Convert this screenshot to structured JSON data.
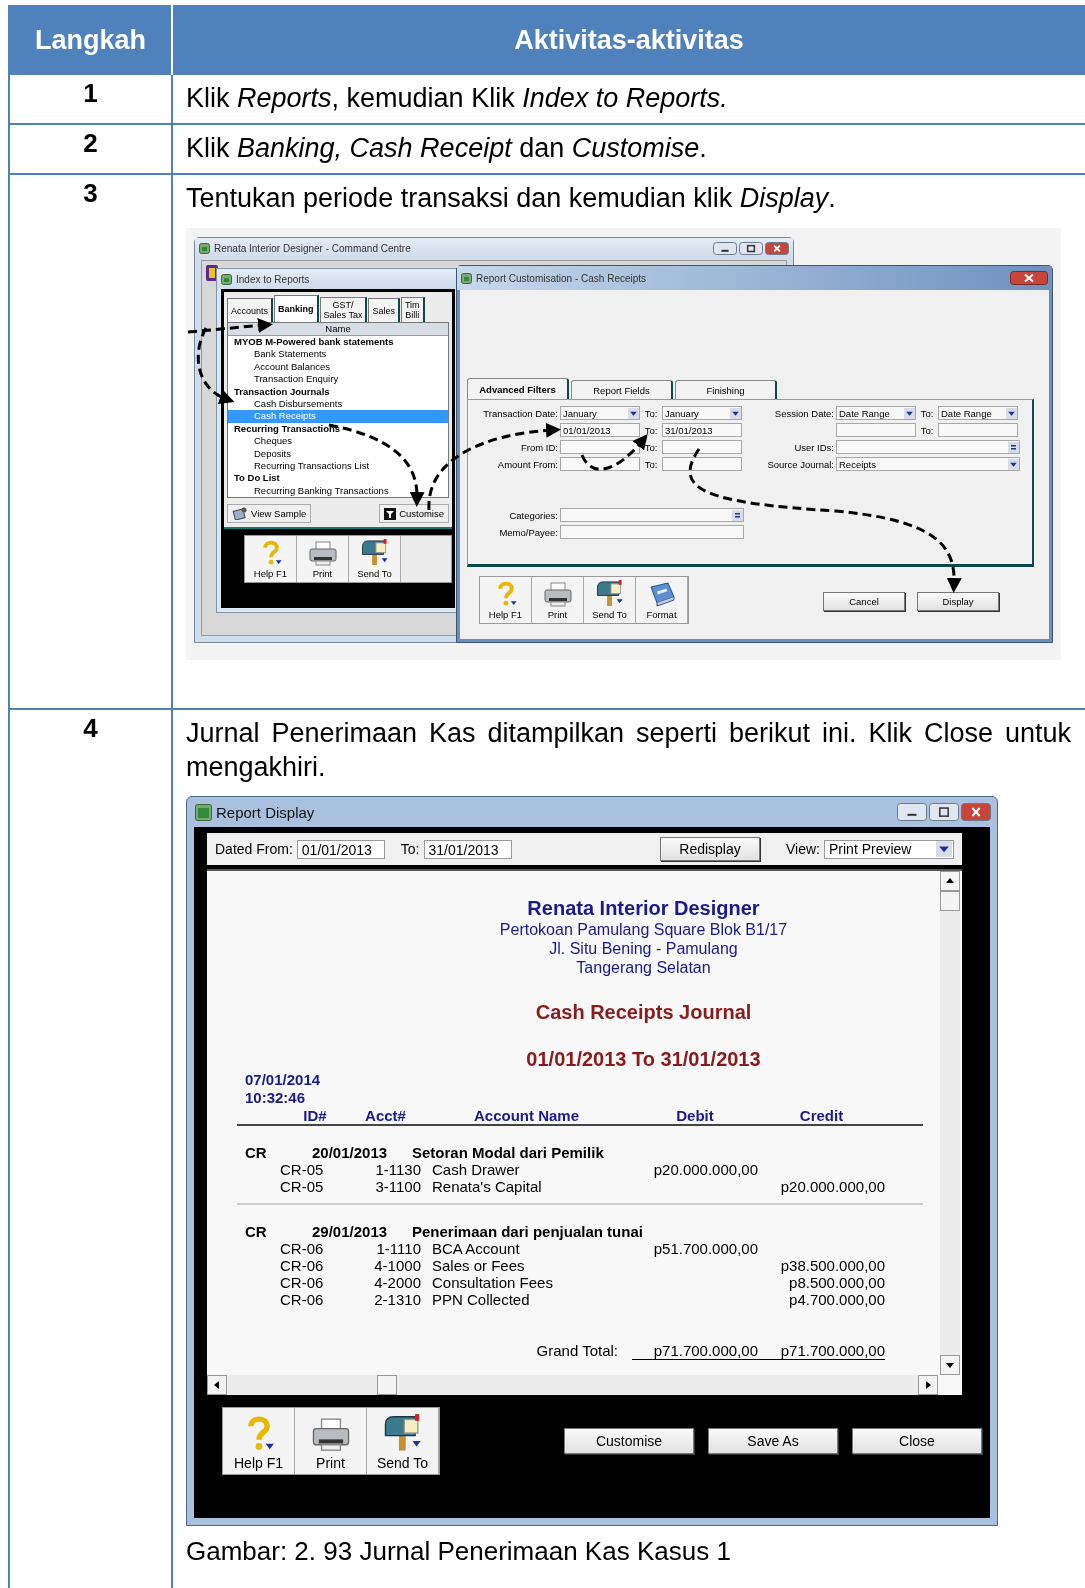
{
  "header": {
    "step": "Langkah",
    "activities": "Aktivitas-aktivitas"
  },
  "steps": [
    {
      "number": "1",
      "text": "Klik *Reports*, kemudian Klik *Index to Reports.*"
    },
    {
      "number": "2",
      "text": "Klik *Banking, Cash Receipt* dan *Customise*."
    },
    {
      "number": "3",
      "text": "Tentukan periode transaksi dan kemudian klik *Display*.",
      "figure": {
        "kind": "customise",
        "command_centre": {
          "title": "Renata Interior Designer - Command Centre"
        },
        "index": {
          "title": "Index to Reports",
          "tabs": [
            {
              "label": "Accounts",
              "selected": false
            },
            {
              "label": "Banking",
              "selected": true
            },
            {
              "label": "GST/\nSales Tax",
              "selected": false
            },
            {
              "label": "Sales",
              "selected": false
            },
            {
              "label": "Tim\nBilli",
              "selected": false
            }
          ],
          "list_header": "Name",
          "groups": [
            {
              "label": "MYOB M-Powered bank statements",
              "children": [
                {
                  "label": "Bank Statements",
                  "selected": false
                },
                {
                  "label": "Account Balances",
                  "selected": false
                },
                {
                  "label": "Transaction Enquiry",
                  "selected": false
                }
              ]
            },
            {
              "label": "Transaction Journals",
              "children": [
                {
                  "label": "Cash Disbursements",
                  "selected": false
                },
                {
                  "label": "Cash Receipts",
                  "selected": true
                }
              ]
            },
            {
              "label": "Recurring Transactions",
              "children": [
                {
                  "label": "Cheques",
                  "selected": false
                },
                {
                  "label": "Deposits",
                  "selected": false
                },
                {
                  "label": "Recurring Transactions List",
                  "selected": false
                }
              ]
            },
            {
              "label": "To Do List",
              "children": [
                {
                  "label": "Recurring Banking Transactions",
                  "selected": false
                }
              ]
            }
          ],
          "buttons": [
            {
              "kind": "view-sample",
              "label": "View Sample"
            },
            {
              "kind": "customise",
              "label": "Customise"
            }
          ],
          "toolbar": [
            {
              "kind": "help",
              "label": "Help F1"
            },
            {
              "kind": "print",
              "label": "Print"
            },
            {
              "kind": "send",
              "label": "Send To"
            }
          ]
        },
        "customisation": {
          "title": "Report Customisation - Cash Receipts",
          "tabs": [
            {
              "label": "Advanced Filters",
              "selected": true
            },
            {
              "label": "Report Fields",
              "selected": false
            },
            {
              "label": "Finishing",
              "selected": false
            }
          ],
          "left_rows": [
            {
              "label": "Transaction Date:",
              "field": {
                "kind": "dropdown",
                "value": "January"
              },
              "to_label": "To:",
              "to_field": {
                "kind": "dropdown",
                "value": "January"
              }
            },
            {
              "field": {
                "kind": "text",
                "value": "01/01/2013"
              },
              "to_label": "To:",
              "to_field": {
                "kind": "text",
                "value": "31/01/2013"
              }
            },
            {
              "label": "From ID:",
              "field": {
                "kind": "text"
              },
              "to_label": "To:",
              "to_field": {
                "kind": "text"
              }
            },
            {
              "label": "Amount From:",
              "field": {
                "kind": "text"
              },
              "to_label": "To:",
              "to_field": {
                "kind": "text"
              }
            }
          ],
          "right_rows": [
            {
              "label": "Session Date:",
              "field": {
                "kind": "dropdown",
                "value": "Date Range"
              },
              "to_label": "To:",
              "to_field": {
                "kind": "dropdown",
                "value": "Date Range"
              }
            },
            {
              "field": {
                "kind": "text"
              },
              "to_label": "To:",
              "to_field": {
                "kind": "text"
              }
            },
            {
              "label": "User IDs:",
              "field": {
                "kind": "list"
              }
            },
            {
              "label": "Source Journal:",
              "field": {
                "kind": "dropdown",
                "value": "Receipts"
              }
            }
          ],
          "lower_rows": [
            {
              "label": "Categories:",
              "field": {
                "kind": "list"
              }
            },
            {
              "label": "Memo/Payee:",
              "field": {
                "kind": "text"
              }
            }
          ],
          "toolbar": [
            {
              "kind": "help",
              "label": "Help F1"
            },
            {
              "kind": "print",
              "label": "Print"
            },
            {
              "kind": "send",
              "label": "Send To"
            },
            {
              "kind": "format",
              "label": "Format"
            }
          ],
          "buttons": [
            "Cancel",
            "Display"
          ]
        }
      }
    },
    {
      "number": "4",
      "text": "Jurnal Penerimaan Kas ditampilkan seperti berikut ini. Klik Close untuk mengakhiri.",
      "figure": {
        "kind": "report",
        "title": "Report Display",
        "filters": {
          "from_label": "Dated From:",
          "from": "01/01/2013",
          "to_label": "To:",
          "to": "31/01/2013",
          "redisplay": "Redisplay",
          "view_label": "View:",
          "view": "Print Preview"
        },
        "report": {
          "company": "Renata Interior Designer",
          "address": [
            "Pertokoan Pamulang Square Blok B1/17",
            "Jl. Situ Bening - Pamulang",
            "Tangerang Selatan"
          ],
          "title": "Cash Receipts Journal",
          "period": "01/01/2013 To 31/01/2013",
          "date": "07/01/2014",
          "time": "10:32:46",
          "columns": [
            "ID#",
            "Acct#",
            "Account Name",
            "Debit",
            "Credit"
          ],
          "entries": [
            {
              "type": "CR",
              "date": "20/01/2013",
              "memo": "Setoran Modal dari Pemilik",
              "lines": [
                {
                  "id": "CR-05",
                  "acct": "1-1130",
                  "name": "Cash Drawer",
                  "debit": "p20.000.000,00"
                },
                {
                  "id": "CR-05",
                  "acct": "3-1100",
                  "name": "Renata's Capital",
                  "credit": "p20.000.000,00"
                }
              ]
            },
            {
              "type": "CR",
              "date": "29/01/2013",
              "memo": "Penerimaan dari penjualan tunai",
              "lines": [
                {
                  "id": "CR-06",
                  "acct": "1-1110",
                  "name": "BCA Account",
                  "debit": "p51.700.000,00"
                },
                {
                  "id": "CR-06",
                  "acct": "4-1000",
                  "name": "Sales or Fees",
                  "credit": "p38.500.000,00"
                },
                {
                  "id": "CR-06",
                  "acct": "4-2000",
                  "name": "Consultation Fees",
                  "credit": "p8.500.000,00"
                },
                {
                  "id": "CR-06",
                  "acct": "2-1310",
                  "name": "PPN Collected",
                  "credit": "p4.700.000,00"
                }
              ]
            }
          ],
          "total_label": "Grand Total:",
          "total_debit": "p71.700.000,00",
          "total_credit": "p71.700.000,00"
        },
        "toolbar": [
          {
            "kind": "help",
            "label": "Help F1"
          },
          {
            "kind": "print",
            "label": "Print"
          },
          {
            "kind": "send",
            "label": "Send To"
          }
        ],
        "buttons": [
          "Customise",
          "Save As",
          "Close"
        ]
      },
      "caption": "Gambar: 2. 93 Jurnal Penerimaan Kas Kasus 1"
    }
  ]
}
